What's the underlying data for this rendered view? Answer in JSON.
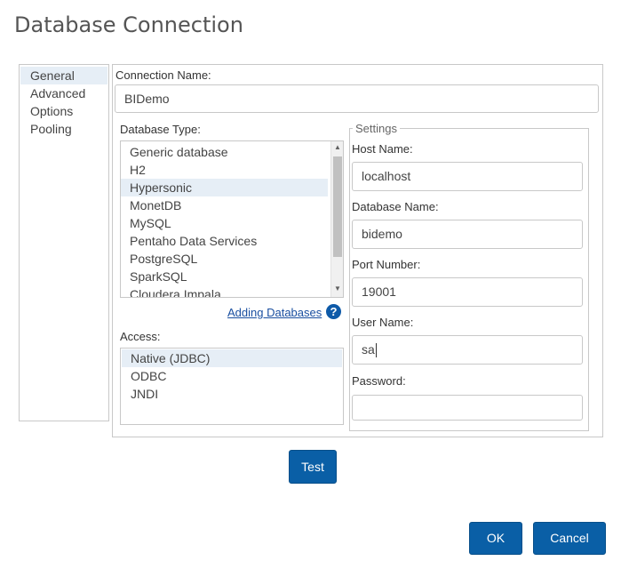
{
  "dialog": {
    "title": "Database Connection"
  },
  "sidebar": {
    "items": [
      {
        "label": "General",
        "selected": true
      },
      {
        "label": "Advanced",
        "selected": false
      },
      {
        "label": "Options",
        "selected": false
      },
      {
        "label": "Pooling",
        "selected": false
      }
    ]
  },
  "general": {
    "connection_name_label": "Connection Name:",
    "connection_name_value": "BIDemo",
    "database_type_label": "Database Type:",
    "database_types": [
      {
        "label": "Generic database",
        "selected": false
      },
      {
        "label": "H2",
        "selected": false
      },
      {
        "label": "Hypersonic",
        "selected": true
      },
      {
        "label": "MonetDB",
        "selected": false
      },
      {
        "label": "MySQL",
        "selected": false
      },
      {
        "label": "Pentaho Data Services",
        "selected": false
      },
      {
        "label": "PostgreSQL",
        "selected": false
      },
      {
        "label": "SparkSQL",
        "selected": false
      },
      {
        "label": "Cloudera Impala",
        "selected": false
      }
    ],
    "adding_databases_link": "Adding Databases",
    "help_icon_glyph": "?",
    "access_label": "Access:",
    "access_types": [
      {
        "label": "Native (JDBC)",
        "selected": true
      },
      {
        "label": "ODBC",
        "selected": false
      },
      {
        "label": "JNDI",
        "selected": false
      }
    ]
  },
  "settings": {
    "legend": "Settings",
    "host_name_label": "Host Name:",
    "host_name_value": "localhost",
    "database_name_label": "Database Name:",
    "database_name_value": "bidemo",
    "port_number_label": "Port Number:",
    "port_number_value": "19001",
    "user_name_label": "User Name:",
    "user_name_value": "sa",
    "password_label": "Password:",
    "password_value": ""
  },
  "buttons": {
    "test": "Test",
    "ok": "OK",
    "cancel": "Cancel"
  },
  "colors": {
    "accent": "#0a5fa6",
    "selection": "#e6eef6",
    "link": "#1a4fa0"
  }
}
